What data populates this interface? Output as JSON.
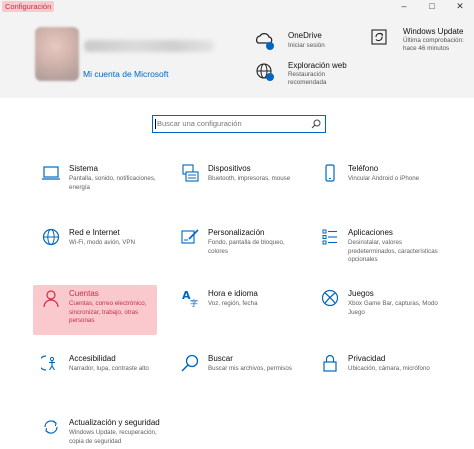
{
  "window": {
    "title": "Configuración",
    "controls": {
      "minimize": "–",
      "maximize": "□",
      "close": "✕"
    }
  },
  "account": {
    "link": "Mi cuenta de Microsoft"
  },
  "header_items": [
    {
      "title": "OneDrive",
      "sub": [
        "Iniciar sesión"
      ]
    },
    {
      "title": "Exploración web",
      "sub": [
        "Restauración",
        "recomendada"
      ]
    },
    {
      "title": "Windows Update",
      "sub": [
        "Última comprobación:",
        "hace 46 minutos"
      ]
    }
  ],
  "search": {
    "placeholder": "Buscar una configuración"
  },
  "categories": [
    {
      "title": "Sistema",
      "desc": "Pantalla, sonido, notificaciones, energía",
      "icon": "laptop-icon"
    },
    {
      "title": "Dispositivos",
      "desc": "Bluetooth, impresoras, mouse",
      "icon": "keyboard-icon"
    },
    {
      "title": "Teléfono",
      "desc": "Vincular Android o iPhone",
      "icon": "phone-icon"
    },
    {
      "title": "Red e Internet",
      "desc": "Wi-Fi, modo avión, VPN",
      "icon": "globe-icon"
    },
    {
      "title": "Personalización",
      "desc": "Fondo, pantalla de bloqueo, colores",
      "icon": "brush-icon"
    },
    {
      "title": "Aplicaciones",
      "desc": "Desinstalar, valores predeterminados, características opcionales",
      "icon": "apps-list-icon"
    },
    {
      "title": "Cuentas",
      "desc": "Cuentas, correo electrónico, sincronizar, trabajo, otras personas",
      "icon": "person-icon"
    },
    {
      "title": "Hora e idioma",
      "desc": "Voz, región, fecha",
      "icon": "time-language-icon"
    },
    {
      "title": "Juegos",
      "desc": "Xbox Game Bar, capturas, Modo Juego",
      "icon": "xbox-icon"
    },
    {
      "title": "Accesibilidad",
      "desc": "Narrador, lupa, contraste alto",
      "icon": "accessibility-icon"
    },
    {
      "title": "Buscar",
      "desc": "Buscar mis archivos, permisos",
      "icon": "search-icon"
    },
    {
      "title": "Privacidad",
      "desc": "Ubicación, cámara, micrófono",
      "icon": "lock-icon"
    },
    {
      "title": "Actualización y seguridad",
      "desc": "Windows Update, recuperación, copia de seguridad",
      "icon": "update-icon"
    }
  ],
  "colors": {
    "accent": "#0067c0",
    "selection": "#f9c9cd",
    "selection_text": "#c4314b"
  }
}
